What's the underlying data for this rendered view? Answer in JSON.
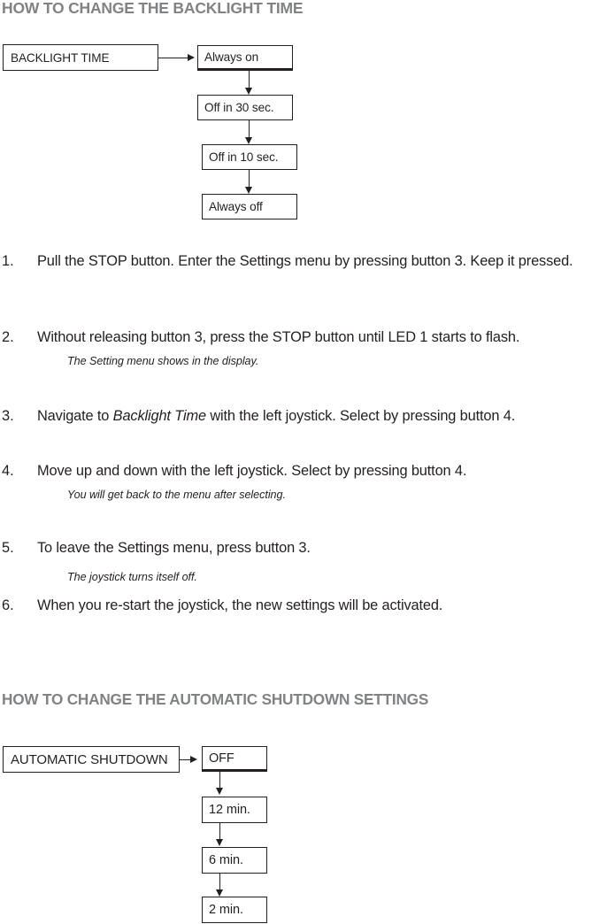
{
  "sections": {
    "backlight": {
      "heading": "HOW TO CHANGE THE BACKLIGHT TIME",
      "flowchart": {
        "root_label": "BACKLIGHT TIME",
        "options": [
          "Always on",
          "Off in 30 sec.",
          "Off in 10 sec.",
          "Always off"
        ]
      },
      "steps": [
        {
          "number": "1.",
          "text": "Pull the STOP button. Enter the Settings menu by pressing button 3. Keep it pressed.",
          "note": ""
        },
        {
          "number": "2.",
          "text": "Without releasing button 3, press the STOP button until LED 1 starts to flash.",
          "note": "The Setting menu shows in the display."
        },
        {
          "number": "3.",
          "text_pre": "Navigate to ",
          "text_em": "Backlight Time",
          "text_post": " with the left joystick. Select by pressing button 4.",
          "note": ""
        },
        {
          "number": "4.",
          "text": "Move up and down with the left joystick. Select by pressing button 4.",
          "note": "You will get back to the menu after selecting."
        },
        {
          "number": "5.",
          "text": "To leave the Settings menu, press button 3.",
          "note": "The joystick turns itself off."
        },
        {
          "number": "6.",
          "text": "When you re-start the joystick, the new settings will be activated.",
          "note": ""
        }
      ]
    },
    "shutdown": {
      "heading": "HOW TO CHANGE THE AUTOMATIC SHUTDOWN SETTINGS",
      "flowchart": {
        "root_label": "AUTOMATIC SHUTDOWN",
        "options": [
          "OFF",
          "12 min.",
          "6 min.",
          "2 min."
        ]
      }
    }
  },
  "colors": {
    "heading_gray": "#808284",
    "body_black": "#231f20"
  }
}
